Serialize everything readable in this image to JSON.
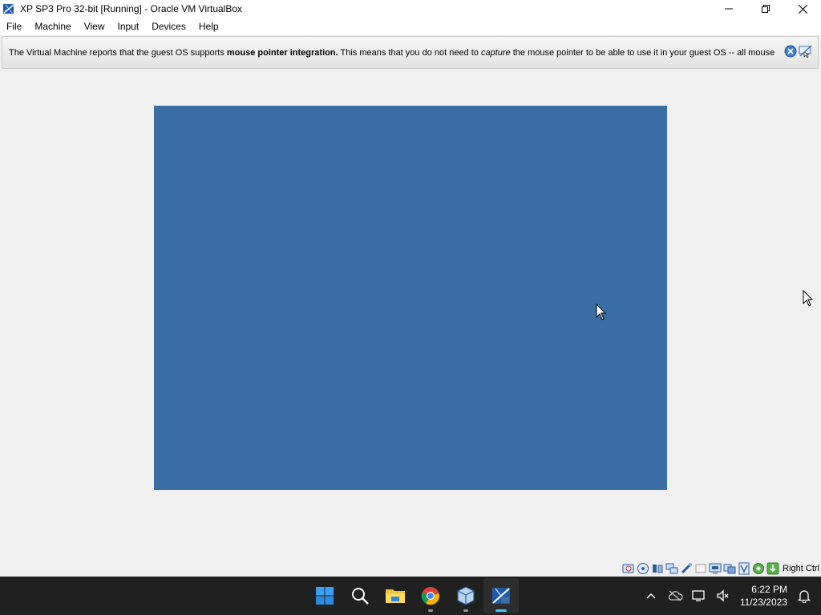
{
  "window": {
    "title": "XP SP3 Pro 32-bit [Running] - Oracle VM VirtualBox",
    "icon": "virtualbox-xp-icon"
  },
  "menu": {
    "items": [
      {
        "label": "File"
      },
      {
        "label": "Machine"
      },
      {
        "label": "View"
      },
      {
        "label": "Input"
      },
      {
        "label": "Devices"
      },
      {
        "label": "Help"
      }
    ]
  },
  "notice": {
    "part1": "The Virtual Machine reports that the guest OS supports ",
    "bold": "mouse pointer integration.",
    "part2": " This means that you do not need to ",
    "italic": "capture",
    "part3": " the mouse pointer to be able to use it in your guest OS -- all mouse"
  },
  "vm": {
    "screen_color": "#3b6ea5"
  },
  "statusbar": {
    "icons": [
      "hard-disk-icon",
      "optical-drive-icon",
      "audio-icon",
      "network-icon",
      "usb-icon",
      "shared-folders-icon",
      "display-icon",
      "video-capture-icon",
      "cpu-virtualization-icon",
      "mouse-integration-icon",
      "keyboard-capture-icon"
    ],
    "host_key": "Right Ctrl"
  },
  "taskbar": {
    "apps": [
      "start-icon",
      "search-icon",
      "file-explorer-icon",
      "chrome-icon",
      "virtualbox-icon",
      "virtualbox-xp-vm-icon"
    ],
    "time": "6:22 PM",
    "date": "11/23/2023"
  },
  "colors": {
    "taskbar": "#202020",
    "accent": "#4cc2ff",
    "vm_blue": "#3b6ea5"
  }
}
